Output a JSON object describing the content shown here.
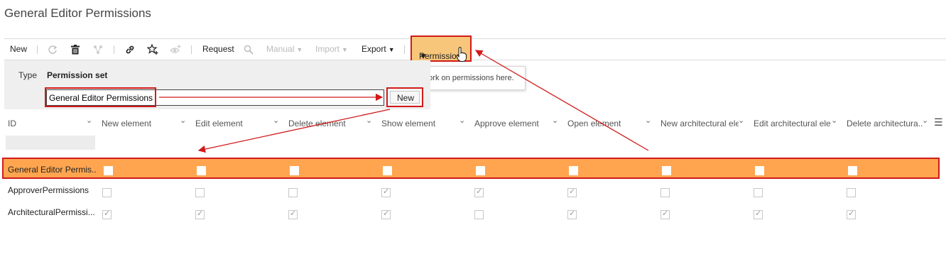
{
  "page": {
    "title": "General Editor Permissions"
  },
  "toolbar": {
    "new_label": "New",
    "request_label": "Request",
    "manual_label": "Manual",
    "import_label": "Import",
    "export_label": "Export",
    "permissions_label": "Permissions",
    "icons": [
      "refresh-icon",
      "delete-icon",
      "hierarchy-icon",
      "link-icon",
      "star-add-icon",
      "eye-add-icon",
      "search-icon"
    ]
  },
  "tooltip": {
    "text": "Work on permissions here."
  },
  "form": {
    "type_label": "Type",
    "permission_set_label": "Permission set",
    "name_value": "General Editor Permissions",
    "new_button_label": "New"
  },
  "grid": {
    "columns": [
      "ID",
      "New element",
      "Edit element",
      "Delete element",
      "Show element",
      "Approve element",
      "Open element",
      "New architectural ele...",
      "Edit architectural ele...",
      "Delete architectura..."
    ],
    "rows": [
      {
        "id": "General Editor Permis...",
        "selected": true,
        "checks": [
          false,
          false,
          false,
          false,
          false,
          false,
          false,
          false,
          false
        ]
      },
      {
        "id": "ApproverPermissions",
        "selected": false,
        "checks": [
          false,
          false,
          false,
          true,
          true,
          true,
          false,
          false,
          false
        ]
      },
      {
        "id": "ArchitecturalPermissi...",
        "selected": false,
        "checks": [
          true,
          true,
          true,
          true,
          false,
          true,
          true,
          true,
          true
        ]
      }
    ]
  },
  "colors": {
    "annotation": "#d11a1a",
    "selected_row": "#ffa54f",
    "permissions_button": "#f7c67a"
  }
}
